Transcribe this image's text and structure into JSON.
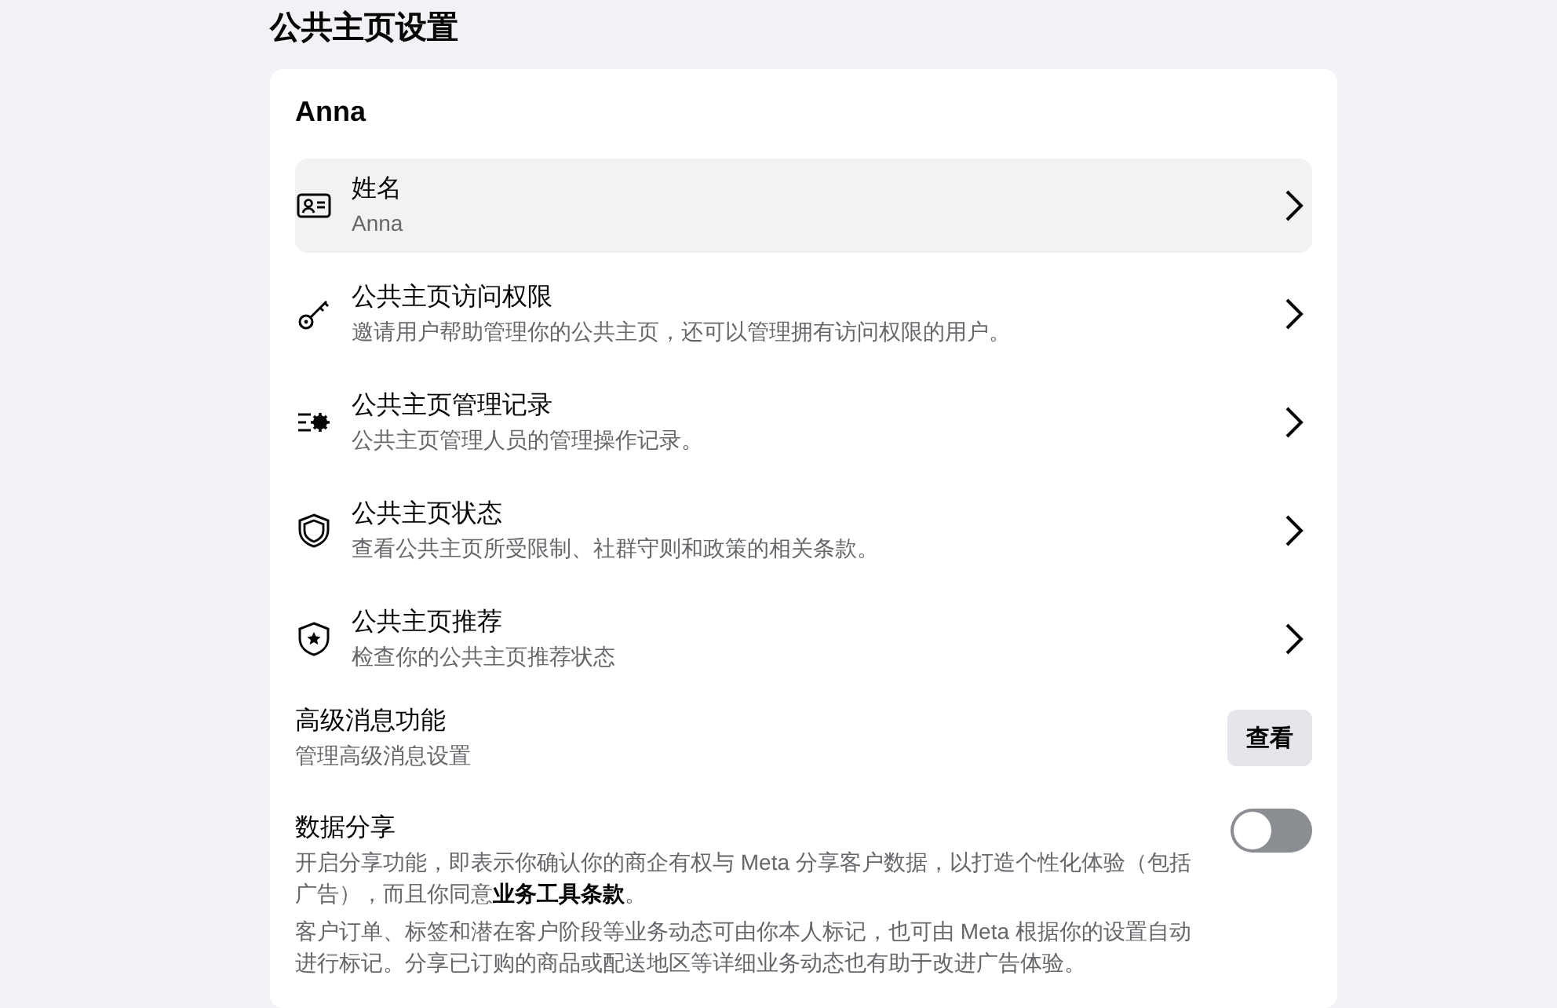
{
  "page_title": "公共主页设置",
  "card": {
    "title": "Anna",
    "nav_items": [
      {
        "title": "姓名",
        "subtitle": "Anna",
        "selected": true
      },
      {
        "title": "公共主页访问权限",
        "subtitle": "邀请用户帮助管理你的公共主页，还可以管理拥有访问权限的用户。",
        "selected": false
      },
      {
        "title": "公共主页管理记录",
        "subtitle": "公共主页管理人员的管理操作记录。",
        "selected": false
      },
      {
        "title": "公共主页状态",
        "subtitle": "查看公共主页所受限制、社群守则和政策的相关条款。",
        "selected": false
      },
      {
        "title": "公共主页推荐",
        "subtitle": "检查你的公共主页推荐状态",
        "selected": false
      }
    ],
    "advanced_messaging": {
      "title": "高级消息功能",
      "subtitle": "管理高级消息设置",
      "button": "查看"
    },
    "data_sharing": {
      "title": "数据分享",
      "on": false,
      "paragraphs": [
        "开启分享功能，即表示你确认你的商企有权与 Meta 分享客户数据，以打造个性化体验（包括广告），而且你同意**业务工具条款**。",
        "客户订单、标签和潜在客户阶段等业务动态可由你本人标记，也可由 Meta 根据你的设置自动进行标记。分享已订购的商品或配送地区等详细业务动态也有助于改进广告体验。"
      ]
    }
  }
}
